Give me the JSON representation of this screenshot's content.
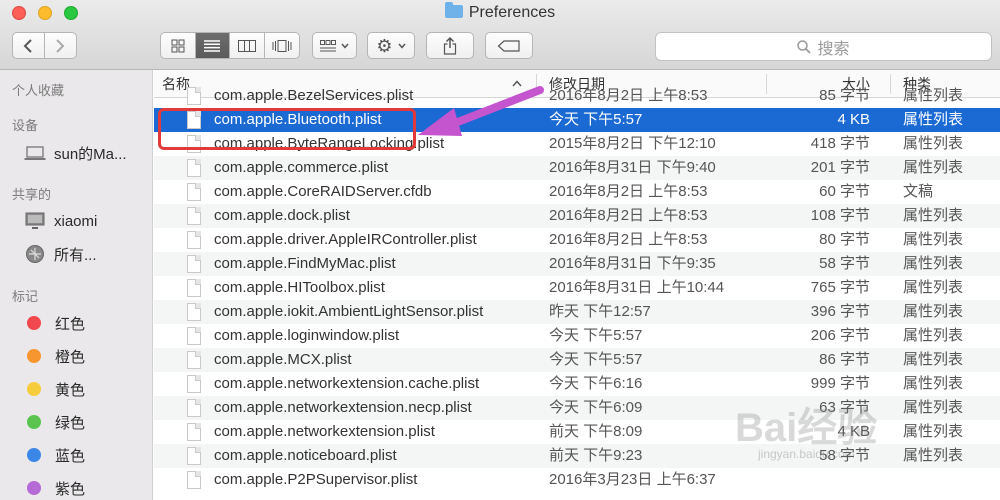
{
  "window": {
    "title": "Preferences"
  },
  "toolbar": {
    "back_icon": "chevron-left-icon",
    "forward_icon": "chevron-right-icon",
    "view_modes": [
      "icon-view-icon",
      "list-view-icon",
      "column-view-icon",
      "coverflow-view-icon"
    ],
    "active_view": "list-view-icon",
    "search_placeholder": "搜索"
  },
  "sidebar": {
    "sections": [
      {
        "heading": "个人收藏",
        "items": []
      },
      {
        "heading": "设备",
        "items": [
          {
            "label": "sun的Ma...",
            "icon": "laptop-icon"
          }
        ]
      },
      {
        "heading": "共享的",
        "items": [
          {
            "label": "xiaomi",
            "icon": "monitor-icon"
          },
          {
            "label": "所有...",
            "icon": "network-icon"
          }
        ]
      },
      {
        "heading": "标记",
        "items": [
          {
            "label": "红色",
            "color": "#f0484d"
          },
          {
            "label": "橙色",
            "color": "#f7962f"
          },
          {
            "label": "黄色",
            "color": "#f7cc3c"
          },
          {
            "label": "绿色",
            "color": "#5ac44f"
          },
          {
            "label": "蓝色",
            "color": "#3b87e8"
          },
          {
            "label": "紫色",
            "color": "#b66ad6"
          }
        ]
      }
    ]
  },
  "columns": {
    "name": "名称",
    "date": "修改日期",
    "size": "大小",
    "kind": "种类"
  },
  "files": [
    {
      "name": "com.apple.BezelServices.plist",
      "date": "2016年8月2日 上午8:53",
      "size": "85 字节",
      "kind": "属性列表"
    },
    {
      "name": "com.apple.Bluetooth.plist",
      "date": "今天 下午5:57",
      "size": "4 KB",
      "kind": "属性列表",
      "selected": true
    },
    {
      "name": "com.apple.ByteRangeLocking.plist",
      "date": "2015年8月2日 下午12:10",
      "size": "418 字节",
      "kind": "属性列表"
    },
    {
      "name": "com.apple.commerce.plist",
      "date": "2016年8月31日 下午9:40",
      "size": "201 字节",
      "kind": "属性列表"
    },
    {
      "name": "com.apple.CoreRAIDServer.cfdb",
      "date": "2016年8月2日 上午8:53",
      "size": "60 字节",
      "kind": "文稿"
    },
    {
      "name": "com.apple.dock.plist",
      "date": "2016年8月2日 上午8:53",
      "size": "108 字节",
      "kind": "属性列表"
    },
    {
      "name": "com.apple.driver.AppleIRController.plist",
      "date": "2016年8月2日 上午8:53",
      "size": "80 字节",
      "kind": "属性列表"
    },
    {
      "name": "com.apple.FindMyMac.plist",
      "date": "2016年8月31日 下午9:35",
      "size": "58 字节",
      "kind": "属性列表"
    },
    {
      "name": "com.apple.HIToolbox.plist",
      "date": "2016年8月31日 上午10:44",
      "size": "765 字节",
      "kind": "属性列表"
    },
    {
      "name": "com.apple.iokit.AmbientLightSensor.plist",
      "date": "昨天 下午12:57",
      "size": "396 字节",
      "kind": "属性列表"
    },
    {
      "name": "com.apple.loginwindow.plist",
      "date": "今天 下午5:57",
      "size": "206 字节",
      "kind": "属性列表"
    },
    {
      "name": "com.apple.MCX.plist",
      "date": "今天 下午5:57",
      "size": "86 字节",
      "kind": "属性列表"
    },
    {
      "name": "com.apple.networkextension.cache.plist",
      "date": "今天 下午6:16",
      "size": "999 字节",
      "kind": "属性列表"
    },
    {
      "name": "com.apple.networkextension.necp.plist",
      "date": "今天 下午6:09",
      "size": "63 字节",
      "kind": "属性列表"
    },
    {
      "name": "com.apple.networkextension.plist",
      "date": "前天 下午8:09",
      "size": "4 KB",
      "kind": "属性列表"
    },
    {
      "name": "com.apple.noticeboard.plist",
      "date": "前天 下午9:23",
      "size": "58 字节",
      "kind": "属性列表"
    },
    {
      "name": "com.apple.P2PSupervisor.plist",
      "date": "2016年3月23日 上午6:37",
      "size": "",
      "kind": ""
    }
  ],
  "watermark": {
    "text": "Bai经验",
    "sub": "jingyan.baidu.com"
  },
  "colors": {
    "selection": "#1b6ad3",
    "annotation_box": "#e23a3a",
    "annotation_arrow": "#c455cf"
  }
}
